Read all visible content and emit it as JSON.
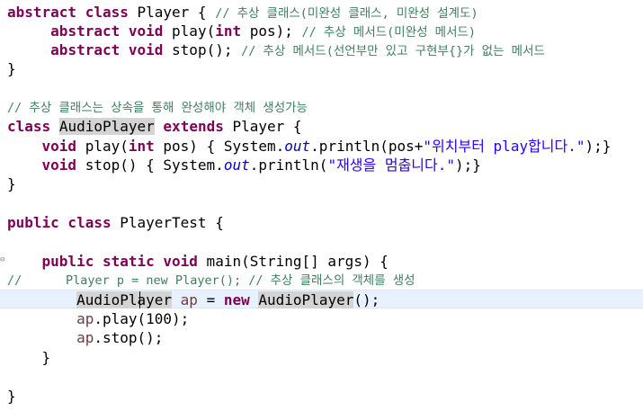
{
  "editor": {
    "lines": [
      {
        "segments": [
          {
            "t": "abstract class",
            "c": "kw"
          },
          {
            "t": " Player { "
          },
          {
            "t": "// 추상 클래스(미완성 클래스, 미완성 설계도)",
            "c": "cm"
          }
        ]
      },
      {
        "segments": [
          {
            "t": "     "
          },
          {
            "t": "abstract void",
            "c": "kw"
          },
          {
            "t": " play("
          },
          {
            "t": "int",
            "c": "kw"
          },
          {
            "t": " pos); "
          },
          {
            "t": "// 추상 메서드(미완성 메서드)",
            "c": "cm"
          }
        ]
      },
      {
        "segments": [
          {
            "t": "     "
          },
          {
            "t": "abstract void",
            "c": "kw"
          },
          {
            "t": " stop(); "
          },
          {
            "t": "// 추상 메서드(선언부만 있고 구현부{}가 없는 메서드",
            "c": "cm"
          }
        ]
      },
      {
        "segments": [
          {
            "t": "}"
          }
        ]
      },
      {
        "segments": []
      },
      {
        "segments": [
          {
            "t": "// 추상 클래스는 상속을 통해 완성해야 객체 생성가능",
            "c": "cm"
          }
        ]
      },
      {
        "segments": [
          {
            "t": "class",
            "c": "kw"
          },
          {
            "t": " "
          },
          {
            "t": "AudioPlayer",
            "c": "hl"
          },
          {
            "t": " "
          },
          {
            "t": "extends",
            "c": "kw"
          },
          {
            "t": " Player {"
          }
        ]
      },
      {
        "segments": [
          {
            "t": "    "
          },
          {
            "t": "void",
            "c": "kw"
          },
          {
            "t": " play("
          },
          {
            "t": "int",
            "c": "kw"
          },
          {
            "t": " pos) { System."
          },
          {
            "t": "out",
            "c": "fld"
          },
          {
            "t": ".println(pos+"
          },
          {
            "t": "\"위치부터 play합니다.\"",
            "c": "str"
          },
          {
            "t": ");}"
          }
        ]
      },
      {
        "segments": [
          {
            "t": "    "
          },
          {
            "t": "void",
            "c": "kw"
          },
          {
            "t": " stop() { System."
          },
          {
            "t": "out",
            "c": "fld"
          },
          {
            "t": ".println("
          },
          {
            "t": "\"재생을 멈춥니다.\"",
            "c": "str"
          },
          {
            "t": ");}"
          }
        ]
      },
      {
        "segments": [
          {
            "t": "}"
          }
        ]
      },
      {
        "segments": []
      },
      {
        "segments": [
          {
            "t": "public class",
            "c": "kw"
          },
          {
            "t": " PlayerTest {"
          }
        ]
      },
      {
        "segments": []
      },
      {
        "segments": [
          {
            "t": "    "
          },
          {
            "t": "public static void",
            "c": "kw"
          },
          {
            "t": " main(String[] args) {"
          }
        ],
        "fold": "⊖"
      },
      {
        "segments": [
          {
            "t": "//      Player p = new Player(); // 추상 클래스의 객체를 생성",
            "c": "cm"
          }
        ]
      },
      {
        "segments": [
          {
            "t": "        "
          },
          {
            "t": "AudioPlayer",
            "c": "hl"
          },
          {
            "t": " "
          },
          {
            "t": "ap",
            "c": "var"
          },
          {
            "t": " = "
          },
          {
            "t": "new",
            "c": "kw"
          },
          {
            "t": " "
          },
          {
            "t": "AudioPlayer",
            "c": "hl"
          },
          {
            "t": "();"
          }
        ],
        "current": true
      },
      {
        "segments": [
          {
            "t": "        "
          },
          {
            "t": "ap",
            "c": "var"
          },
          {
            "t": ".play(100);"
          }
        ]
      },
      {
        "segments": [
          {
            "t": "        "
          },
          {
            "t": "ap",
            "c": "var"
          },
          {
            "t": ".stop();"
          }
        ]
      },
      {
        "segments": [
          {
            "t": "    }"
          }
        ]
      },
      {
        "segments": []
      },
      {
        "segments": [
          {
            "t": "}"
          }
        ]
      }
    ]
  },
  "colors": {
    "keyword": "#7f0055",
    "comment": "#3f7f5f",
    "string": "#2a00ff",
    "field": "#0000c0",
    "local_variable": "#6a3e3e",
    "occurrence_highlight": "#d4d4d4",
    "current_line": "#e8f2fe"
  },
  "icons": [
    "fold-collapse-icon",
    "text-cursor-icon"
  ]
}
